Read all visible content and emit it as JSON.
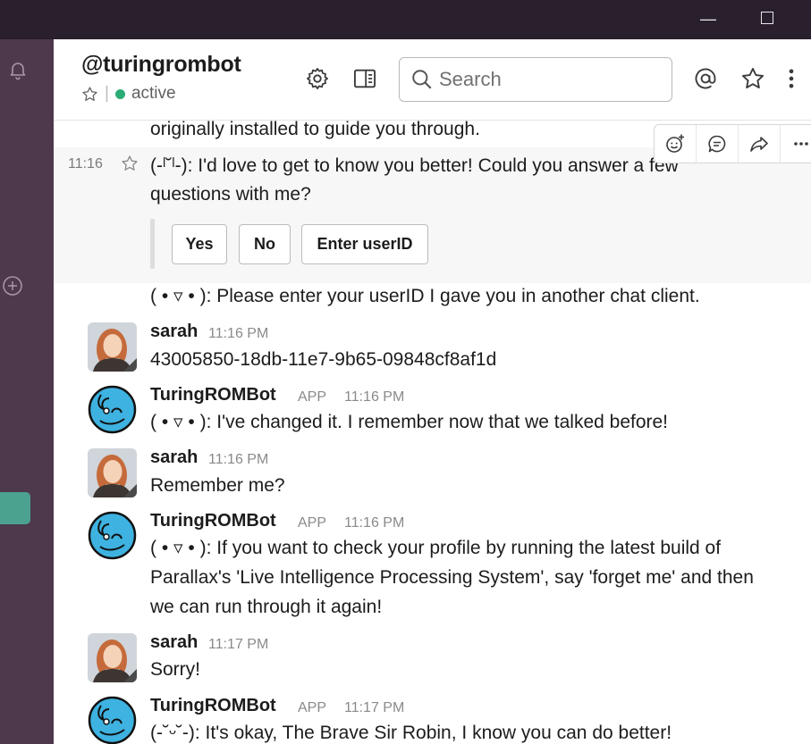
{
  "window": {
    "minimize_glyph": "—"
  },
  "header": {
    "channel_name": "@turingrombot",
    "status": "active",
    "search_placeholder": "Search"
  },
  "messages": {
    "m0_text": "originally installed to guide you through.",
    "m1": {
      "time": "11:16",
      "line1": "(-ˡ˘ˡ-):    I'd love to get to know you better! Could you answer a few",
      "line2": "questions with me?",
      "buttons": [
        "Yes",
        "No",
        "Enter userID"
      ]
    },
    "m2_text": "( • ▿ • ):    Please enter your userID I gave you in another chat client.",
    "m3": {
      "sender": "sarah",
      "time": "11:16 PM",
      "text": "43005850-18db-11e7-9b65-09848cf8af1d"
    },
    "m4": {
      "sender": "TuringROMBot",
      "badge": "APP",
      "time": "11:16 PM",
      "text": "( • ▿ • ):    I've changed it. I remember now that we talked before!"
    },
    "m5": {
      "sender": "sarah",
      "time": "11:16 PM",
      "text": "Remember me?"
    },
    "m6": {
      "sender": "TuringROMBot",
      "badge": "APP",
      "time": "11:16 PM",
      "line1": "( • ▿ • ):    If you want to check your profile by running the latest build of",
      "line2": "Parallax's 'Live Intelligence Processing System', say 'forget me' and then",
      "line3": "we can run through it again!"
    },
    "m7": {
      "sender": "sarah",
      "time": "11:17 PM",
      "text": "Sorry!"
    },
    "m8": {
      "sender": "TuringROMBot",
      "badge": "APP",
      "time": "11:17 PM",
      "text": "(-˘ᵕ˘-):    It's okay, The Brave Sir Robin, I know you can do better!"
    }
  },
  "colors": {
    "titlebar": "#2a1f2c",
    "sidebar": "#4d394b",
    "active_item": "#4ba28f",
    "presence": "#2bac76"
  },
  "icons": [
    "bell-icon",
    "add-circle-icon",
    "star-icon",
    "gear-icon",
    "sidebar-panel-icon",
    "search-icon",
    "mention-icon",
    "more-icon",
    "add-reaction-icon",
    "reply-thread-icon",
    "share-icon"
  ]
}
